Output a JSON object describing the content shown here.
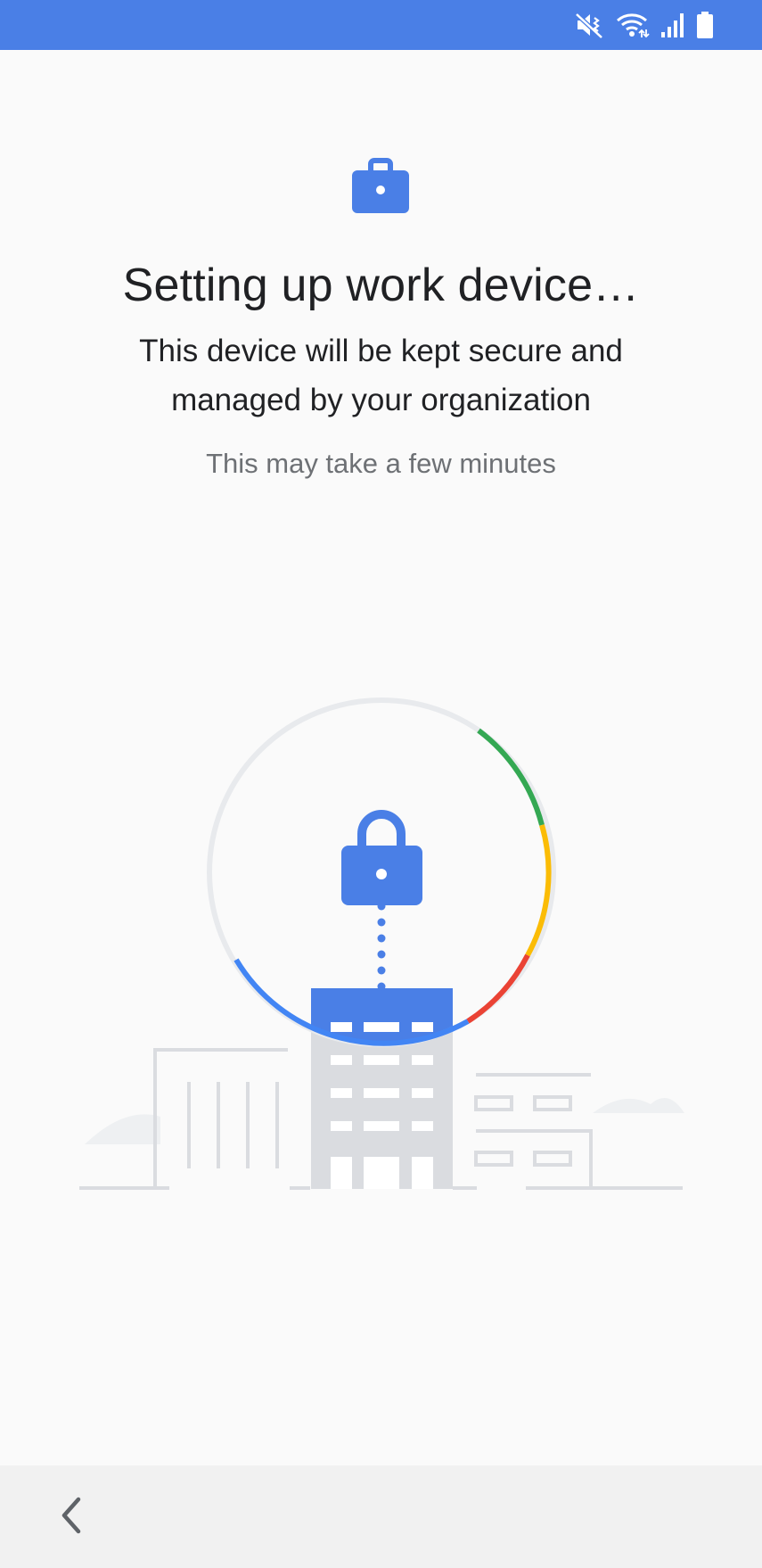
{
  "status_bar": {
    "icons": [
      "mute-vibrate-icon",
      "wifi-icon",
      "signal-icon",
      "battery-icon"
    ],
    "color": "#4a7fe6"
  },
  "header": {
    "icon": "work-briefcase-icon",
    "title": "Setting up work device…",
    "subtitle": "This device will be kept secure and managed by your organization",
    "note": "This may take a few minutes"
  },
  "illustration": {
    "icon": "lock-icon",
    "progress_colors": [
      "#34a853",
      "#fbbc05",
      "#ea4335",
      "#4285f4"
    ],
    "track_color": "#e8eaed"
  },
  "nav_bar": {
    "back_icon": "back-chevron-icon"
  },
  "colors": {
    "accent": "#4285f4",
    "status_bar": "#4a7fe6",
    "background": "#fafafa"
  }
}
